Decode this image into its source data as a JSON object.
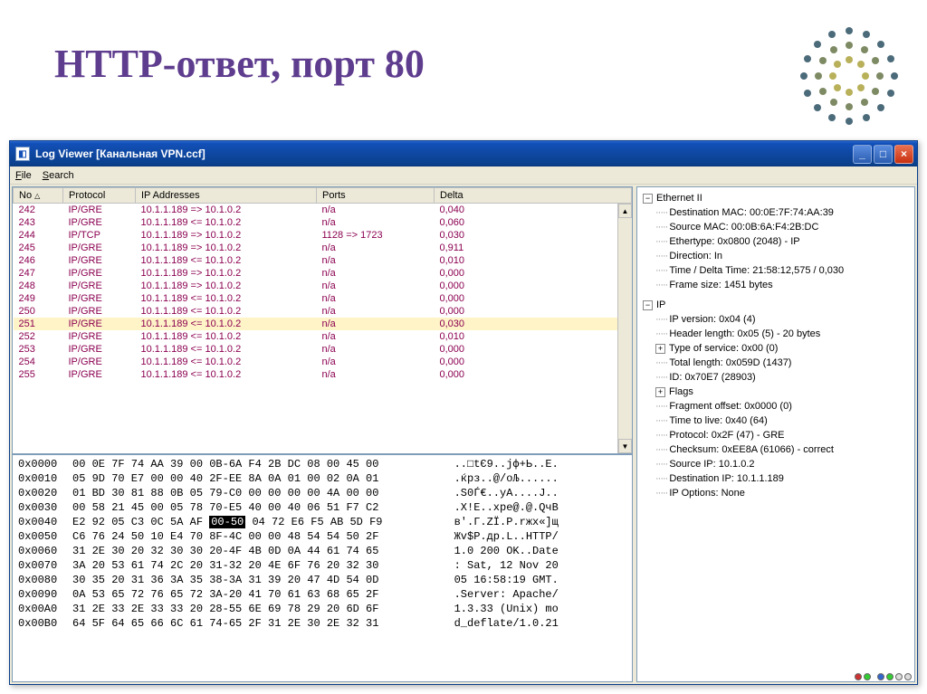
{
  "page_title": "HTTP-ответ, порт 80",
  "window": {
    "title": "Log Viewer [Канальная VPN.ccf]",
    "menus": {
      "file": "File",
      "search": "Search"
    },
    "controls": {
      "min": "_",
      "max": "□",
      "close": "×"
    }
  },
  "columns": {
    "no": "No",
    "protocol": "Protocol",
    "ip": "IP Addresses",
    "ports": "Ports",
    "delta": "Delta"
  },
  "rows": [
    {
      "no": "242",
      "proto": "IP/GRE",
      "ip": "10.1.1.189 => 10.1.0.2",
      "ports": "n/a",
      "delta": "0,040"
    },
    {
      "no": "243",
      "proto": "IP/GRE",
      "ip": "10.1.1.189 <= 10.1.0.2",
      "ports": "n/a",
      "delta": "0,060"
    },
    {
      "no": "244",
      "proto": "IP/TCP",
      "ip": "10.1.1.189 => 10.1.0.2",
      "ports": "1128 => 1723",
      "delta": "0,030"
    },
    {
      "no": "245",
      "proto": "IP/GRE",
      "ip": "10.1.1.189 => 10.1.0.2",
      "ports": "n/a",
      "delta": "0,911"
    },
    {
      "no": "246",
      "proto": "IP/GRE",
      "ip": "10.1.1.189 <= 10.1.0.2",
      "ports": "n/a",
      "delta": "0,010"
    },
    {
      "no": "247",
      "proto": "IP/GRE",
      "ip": "10.1.1.189 => 10.1.0.2",
      "ports": "n/a",
      "delta": "0,000"
    },
    {
      "no": "248",
      "proto": "IP/GRE",
      "ip": "10.1.1.189 => 10.1.0.2",
      "ports": "n/a",
      "delta": "0,000"
    },
    {
      "no": "249",
      "proto": "IP/GRE",
      "ip": "10.1.1.189 <= 10.1.0.2",
      "ports": "n/a",
      "delta": "0,000"
    },
    {
      "no": "250",
      "proto": "IP/GRE",
      "ip": "10.1.1.189 <= 10.1.0.2",
      "ports": "n/a",
      "delta": "0,000"
    },
    {
      "no": "251",
      "proto": "IP/GRE",
      "ip": "10.1.1.189 <= 10.1.0.2",
      "ports": "n/a",
      "delta": "0,030",
      "sel": true
    },
    {
      "no": "252",
      "proto": "IP/GRE",
      "ip": "10.1.1.189 <= 10.1.0.2",
      "ports": "n/a",
      "delta": "0,010"
    },
    {
      "no": "253",
      "proto": "IP/GRE",
      "ip": "10.1.1.189 <= 10.1.0.2",
      "ports": "n/a",
      "delta": "0,000"
    },
    {
      "no": "254",
      "proto": "IP/GRE",
      "ip": "10.1.1.189 <= 10.1.0.2",
      "ports": "n/a",
      "delta": "0,000"
    },
    {
      "no": "255",
      "proto": "IP/GRE",
      "ip": "10.1.1.189 <= 10.1.0.2",
      "ports": "n/a",
      "delta": "0,000"
    }
  ],
  "hex": [
    {
      "addr": "0x0000",
      "b": "00 0E 7F 74 AA 39 00 0B-6A F4 2B DC 08 00 45 00",
      "a": "..□tЄ9..jф+Ь..E."
    },
    {
      "addr": "0x0010",
      "b": "05 9D 70 E7 00 00 40 2F-EE 8A 0A 01 00 02 0A 01",
      "a": ".ќрз..@/оЉ......"
    },
    {
      "addr": "0x0020",
      "b": "01 BD 30 81 88 0B 05 79-C0 00 00 00 00 4A 00 00",
      "a": ".Ѕ0Ѓ€..уА....J.."
    },
    {
      "addr": "0x0030",
      "b": "00 58 21 45 00 05 78 70-E5 40 00 40 06 51 F7 C2",
      "a": ".X!E..xpе@.@.QчВ"
    },
    {
      "addr": "0x0040",
      "b": "E2 92 05 C3 0C 5A AF |00-50| 04 72 E6 F5 AB 5D F9",
      "a": "в'.Г.ZЇ.P.rжх«]щ",
      "hl": "00-50"
    },
    {
      "addr": "0x0050",
      "b": "C6 76 24 50 10 E4 70 8F-4C 00 00 48 54 54 50 2F",
      "a": "Жv$P.дp.L..HTTP/"
    },
    {
      "addr": "0x0060",
      "b": "31 2E 30 20 32 30 30 20-4F 4B 0D 0A 44 61 74 65",
      "a": "1.0 200 OK..Date"
    },
    {
      "addr": "0x0070",
      "b": "3A 20 53 61 74 2C 20 31-32 20 4E 6F 76 20 32 30",
      "a": ": Sat, 12 Nov 20"
    },
    {
      "addr": "0x0080",
      "b": "30 35 20 31 36 3A 35 38-3A 31 39 20 47 4D 54 0D",
      "a": "05 16:58:19 GMT."
    },
    {
      "addr": "0x0090",
      "b": "0A 53 65 72 76 65 72 3A-20 41 70 61 63 68 65 2F",
      "a": ".Server: Apache/"
    },
    {
      "addr": "0x00A0",
      "b": "31 2E 33 2E 33 33 20 28-55 6E 69 78 29 20 6D 6F",
      "a": "1.3.33 (Unix) mo"
    },
    {
      "addr": "0x00B0",
      "b": "64 5F 64 65 66 6C 61 74-65 2F 31 2E 30 2E 32 31",
      "a": "d_deflate/1.0.21"
    }
  ],
  "tree": {
    "eth": {
      "label": "Ethernet II",
      "items": [
        "Destination MAC: 00:0E:7F:74:AA:39",
        "Source MAC: 00:0B:6A:F4:2B:DC",
        "Ethertype: 0x0800 (2048) - IP",
        "Direction: In",
        "Time / Delta Time: 21:58:12,575 / 0,030",
        "Frame size: 1451 bytes"
      ]
    },
    "ip": {
      "label": "IP",
      "items": [
        "IP version: 0x04 (4)",
        "Header length: 0x05 (5) - 20 bytes",
        "Type of service: 0x00 (0)",
        "Total length: 0x059D (1437)",
        "ID: 0x70E7 (28903)",
        "Flags",
        "Fragment offset: 0x0000 (0)",
        "Time to live: 0x40 (64)",
        "Protocol: 0x2F (47) - GRE",
        "Checksum: 0xEE8A (61066) - correct",
        "Source IP: 10.1.0.2",
        "Destination IP: 10.1.1.189",
        "IP Options: None"
      ],
      "expandable": [
        2,
        5
      ]
    }
  }
}
